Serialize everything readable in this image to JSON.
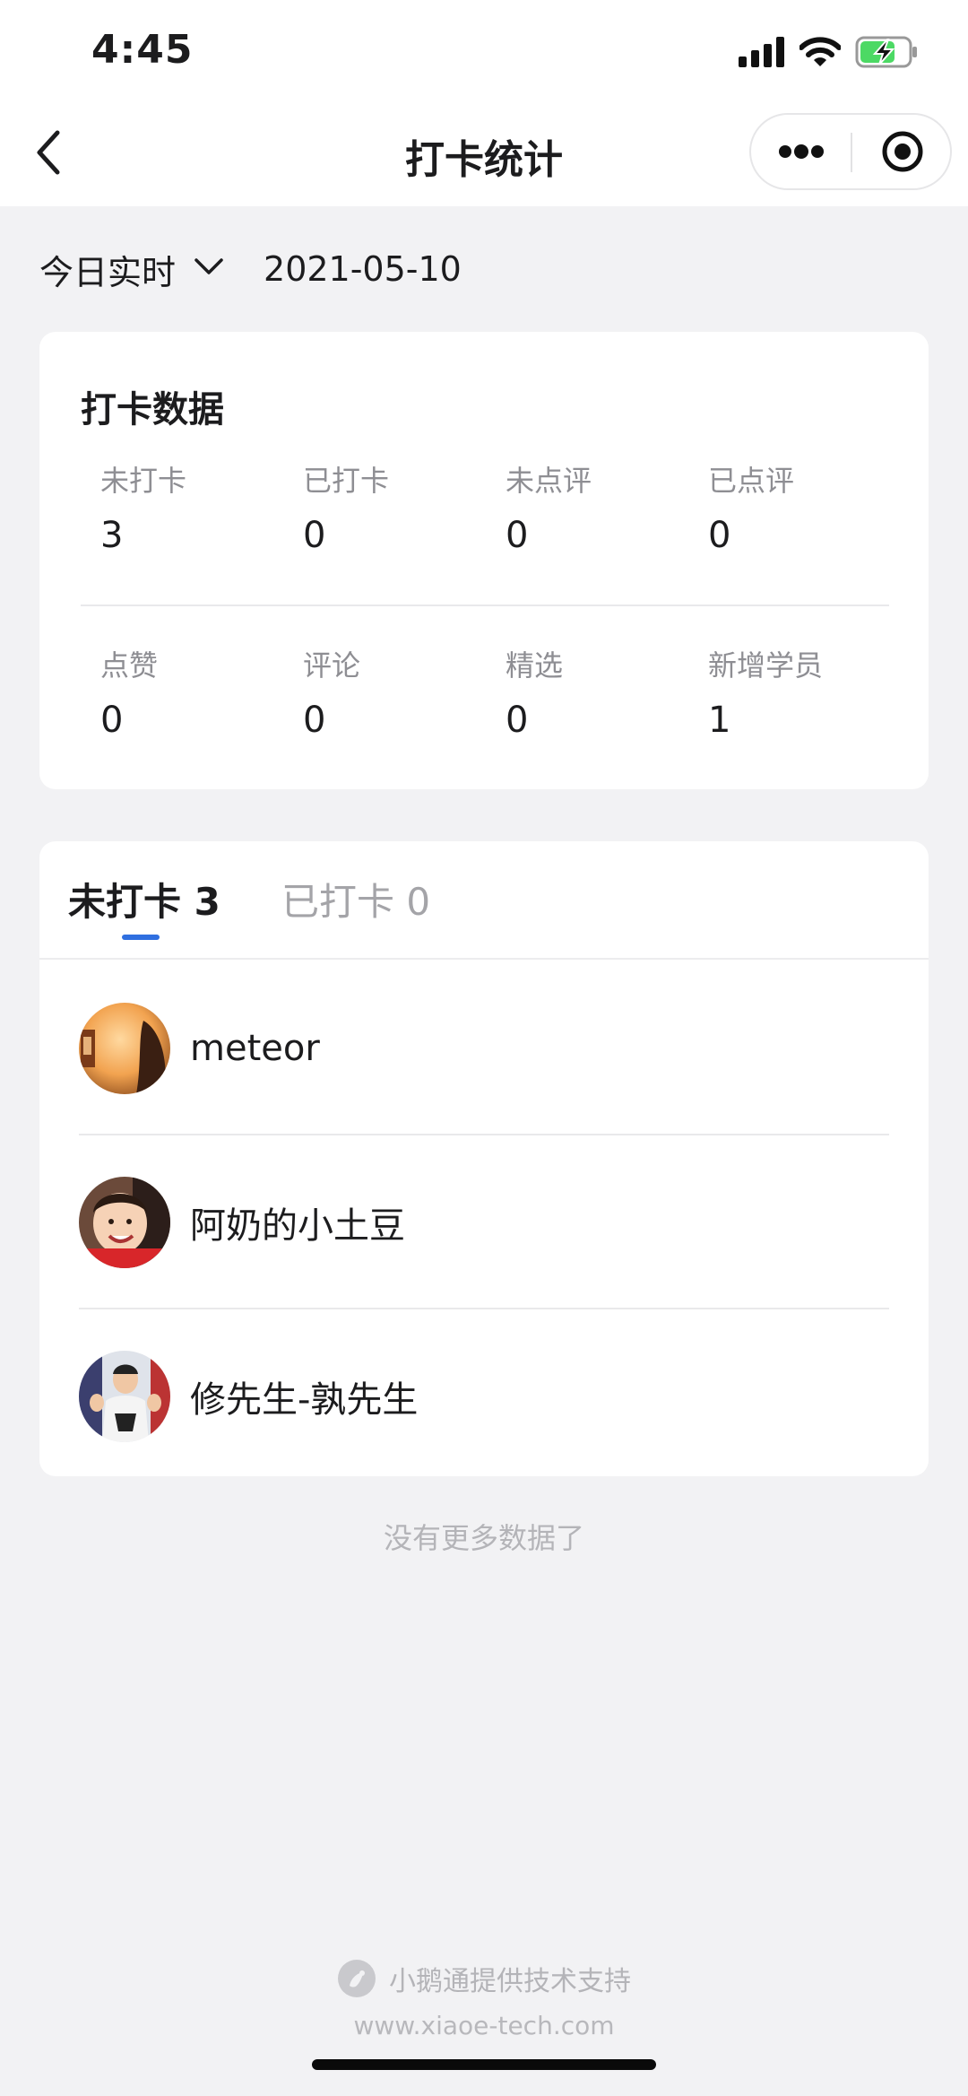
{
  "status_bar": {
    "time": "4:45",
    "icons": [
      "signal-icon",
      "wifi-icon",
      "battery-charging-icon"
    ]
  },
  "nav": {
    "title": "打卡统计",
    "icons": [
      "back-icon",
      "more-icon",
      "mini-program-close-icon"
    ]
  },
  "filter": {
    "period": "今日实时",
    "date": "2021-05-10"
  },
  "stats": {
    "title": "打卡数据",
    "row1": [
      {
        "label": "未打卡",
        "value": "3"
      },
      {
        "label": "已打卡",
        "value": "0"
      },
      {
        "label": "未点评",
        "value": "0"
      },
      {
        "label": "已点评",
        "value": "0"
      }
    ],
    "row2": [
      {
        "label": "点赞",
        "value": "0"
      },
      {
        "label": "评论",
        "value": "0"
      },
      {
        "label": "精选",
        "value": "0"
      },
      {
        "label": "新增学员",
        "value": "1"
      }
    ]
  },
  "tabs": [
    {
      "label": "未打卡 3",
      "active": true
    },
    {
      "label": "已打卡 0",
      "active": false
    }
  ],
  "colors": {
    "accent": "#2f6fe0",
    "background": "#f2f2f4",
    "battery": "#4cd964"
  },
  "members": [
    {
      "name": "meteor"
    },
    {
      "name": "阿奶的小土豆"
    },
    {
      "name": "修先生-孰先生"
    }
  ],
  "no_more": "没有更多数据了",
  "footer": {
    "brand": "小鹅通提供技术支持",
    "url": "www.xiaoe-tech.com"
  }
}
